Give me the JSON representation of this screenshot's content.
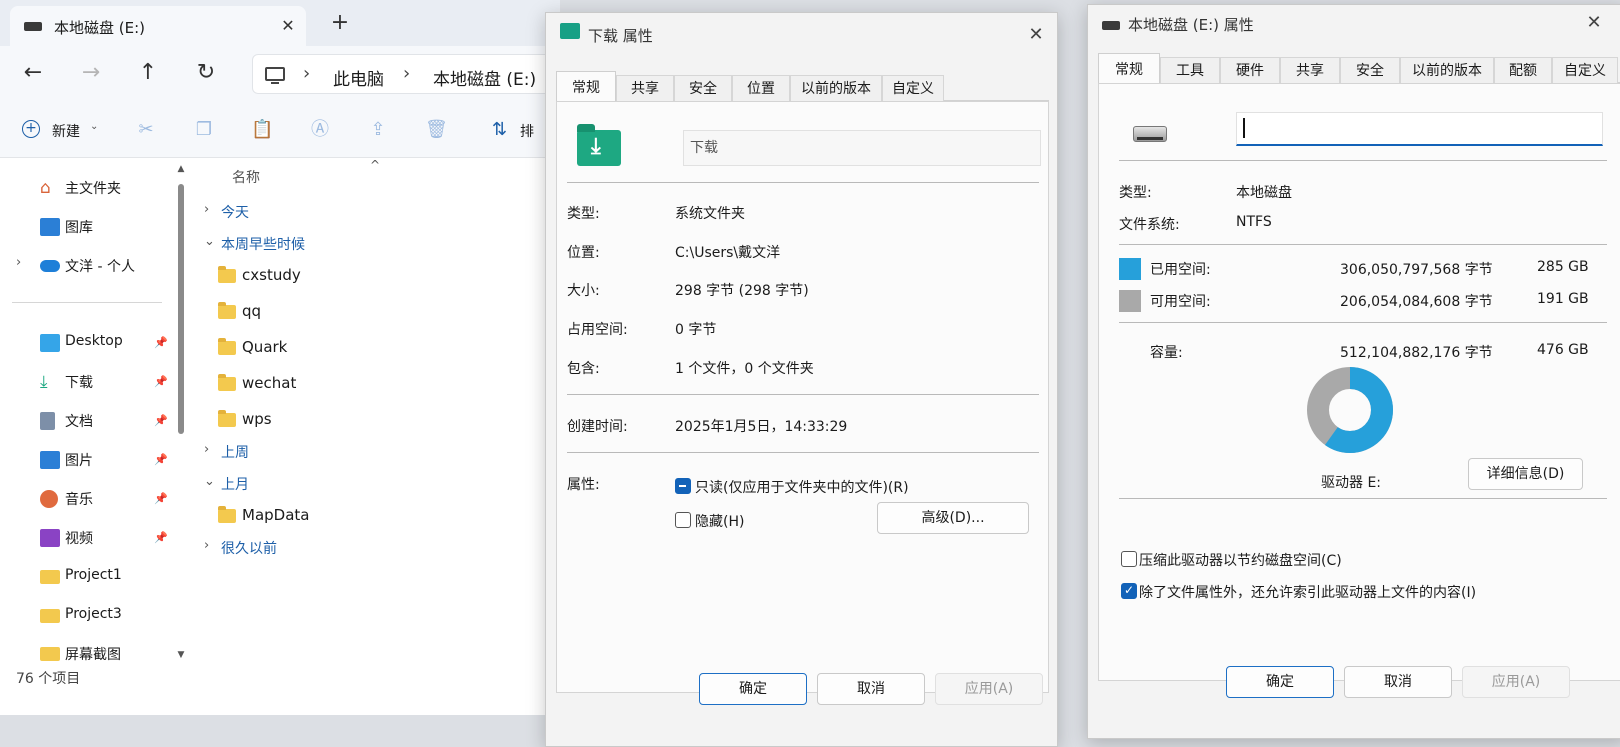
{
  "explorer": {
    "tab_title": "本地磁盘 (E:)",
    "new_tab": "+",
    "breadcrumbs": [
      "此电脑",
      "本地磁盘 (E:)"
    ],
    "new_label": "新建",
    "sort_label": "排",
    "sidebar": {
      "top": [
        {
          "label": "主文件夹",
          "icon": "home-icon"
        },
        {
          "label": "图库",
          "icon": "gallery-icon"
        },
        {
          "label": "文洋 - 个人",
          "icon": "cloud-icon"
        }
      ],
      "pinned": [
        {
          "label": "Desktop",
          "icon": "desktop-icon"
        },
        {
          "label": "下载",
          "icon": "download-icon"
        },
        {
          "label": "文档",
          "icon": "document-icon"
        },
        {
          "label": "图片",
          "icon": "picture-icon"
        },
        {
          "label": "音乐",
          "icon": "music-icon"
        },
        {
          "label": "视频",
          "icon": "video-icon"
        },
        {
          "label": "Project1",
          "icon": "folder-icon"
        },
        {
          "label": "Project3",
          "icon": "folder-icon"
        },
        {
          "label": "屏幕截图",
          "icon": "folder-icon"
        }
      ]
    },
    "column_name": "名称",
    "groups": [
      {
        "label": "今天",
        "expanded": false,
        "items": []
      },
      {
        "label": "本周早些时候",
        "expanded": true,
        "items": [
          "cxstudy",
          "qq",
          "Quark",
          "wechat",
          "wps"
        ]
      },
      {
        "label": "上周",
        "expanded": false,
        "items": []
      },
      {
        "label": "上月",
        "expanded": true,
        "items": [
          "MapData"
        ]
      },
      {
        "label": "很久以前",
        "expanded": false,
        "items": []
      }
    ],
    "status": "76 个项目"
  },
  "download_props": {
    "title": "下载 属性",
    "tabs": [
      "常规",
      "共享",
      "安全",
      "位置",
      "以前的版本",
      "自定义"
    ],
    "name": "下载",
    "rows": [
      {
        "label": "类型:",
        "value": "系统文件夹"
      },
      {
        "label": "位置:",
        "value": "C:\\Users\\戴文洋"
      },
      {
        "label": "大小:",
        "value": "298 字节 (298 字节)"
      },
      {
        "label": "占用空间:",
        "value": "0 字节"
      },
      {
        "label": "包含:",
        "value": "1 个文件，0 个文件夹"
      }
    ],
    "created_label": "创建时间:",
    "created_value": "2025年1月5日，14:33:29",
    "attr_label": "属性:",
    "readonly_label": "只读(仅应用于文件夹中的文件)(R)",
    "hidden_label": "隐藏(H)",
    "advanced_button": "高级(D)...",
    "ok": "确定",
    "cancel": "取消",
    "apply": "应用(A)"
  },
  "drive_props": {
    "title": "本地磁盘 (E:) 属性",
    "tabs": [
      "常规",
      "工具",
      "硬件",
      "共享",
      "安全",
      "以前的版本",
      "配额",
      "自定义"
    ],
    "name_value": "",
    "type_label": "类型:",
    "type_value": "本地磁盘",
    "fs_label": "文件系统:",
    "fs_value": "NTFS",
    "used_label": "已用空间:",
    "used_bytes": "306,050,797,568 字节",
    "used_gb": "285 GB",
    "free_label": "可用空间:",
    "free_bytes": "206,054,084,608 字节",
    "free_gb": "191 GB",
    "cap_label": "容量:",
    "cap_bytes": "512,104,882,176 字节",
    "cap_gb": "476 GB",
    "used_fraction": 0.598,
    "used_color": "#26a0da",
    "free_color": "#a9a9a9",
    "drive_label": "驱动器 E:",
    "details_button": "详细信息(D)",
    "compress_label": "压缩此驱动器以节约磁盘空间(C)",
    "index_label": "除了文件属性外，还允许索引此驱动器上文件的内容(I)",
    "ok": "确定",
    "cancel": "取消",
    "apply": "应用(A)"
  }
}
